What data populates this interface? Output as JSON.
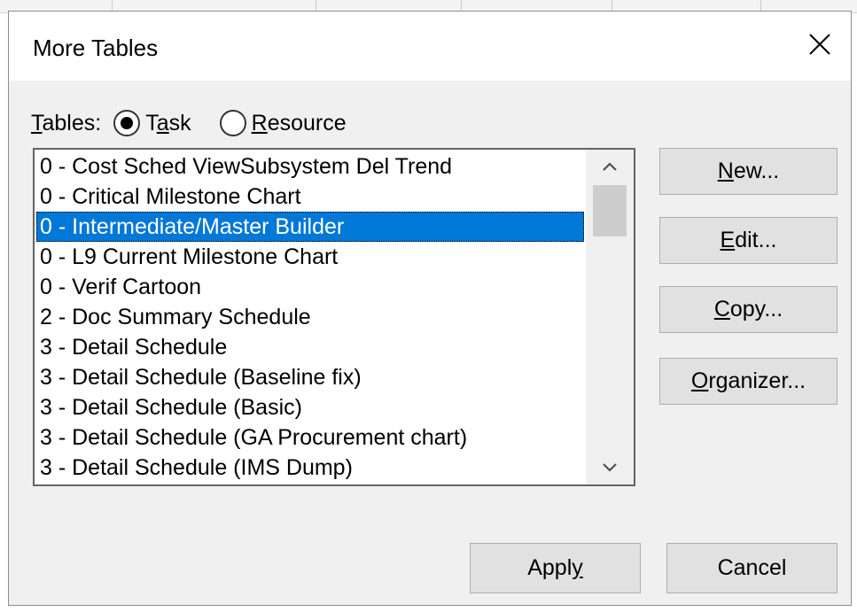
{
  "dialog": {
    "title": "More Tables",
    "close_symbol": "×"
  },
  "tables_filter": {
    "label_mnemonic": "T",
    "label_rest": "ables:",
    "task": {
      "pre": "T",
      "mnemonic": "a",
      "post": "sk",
      "checked": true
    },
    "resource": {
      "pre": "",
      "mnemonic": "R",
      "post": "esource",
      "checked": false
    }
  },
  "tables_list": {
    "selected_index": 2,
    "items": [
      "0 - Cost Sched ViewSubsystem Del Trend",
      "0 - Critical Milestone Chart",
      "0 - Intermediate/Master Builder",
      "0 - L9 Current Milestone Chart",
      "0 - Verif Cartoon",
      "2 - Doc Summary Schedule",
      "3 - Detail Schedule",
      "3 - Detail Schedule (Baseline fix)",
      "3 - Detail Schedule (Basic)",
      "3 - Detail Schedule (GA Procurement chart)",
      "3 - Detail Schedule (IMS Dump)"
    ]
  },
  "buttons": {
    "new": {
      "mnemonic": "N",
      "rest": "ew..."
    },
    "edit": {
      "mnemonic": "E",
      "rest": "dit..."
    },
    "copy": {
      "mnemonic": "C",
      "rest": "opy..."
    },
    "organizer": {
      "mnemonic": "O",
      "rest": "rganizer..."
    },
    "apply": {
      "pre": "Appl",
      "mnemonic": "y"
    },
    "cancel": "Cancel"
  },
  "icons": {
    "close": "close-icon",
    "scroll_up": "chevron-up-icon",
    "scroll_down": "chevron-down-icon"
  },
  "colors": {
    "selection": "#0078d7",
    "dialog_bg": "#f0f0f0",
    "button_bg": "#e1e1e1"
  }
}
